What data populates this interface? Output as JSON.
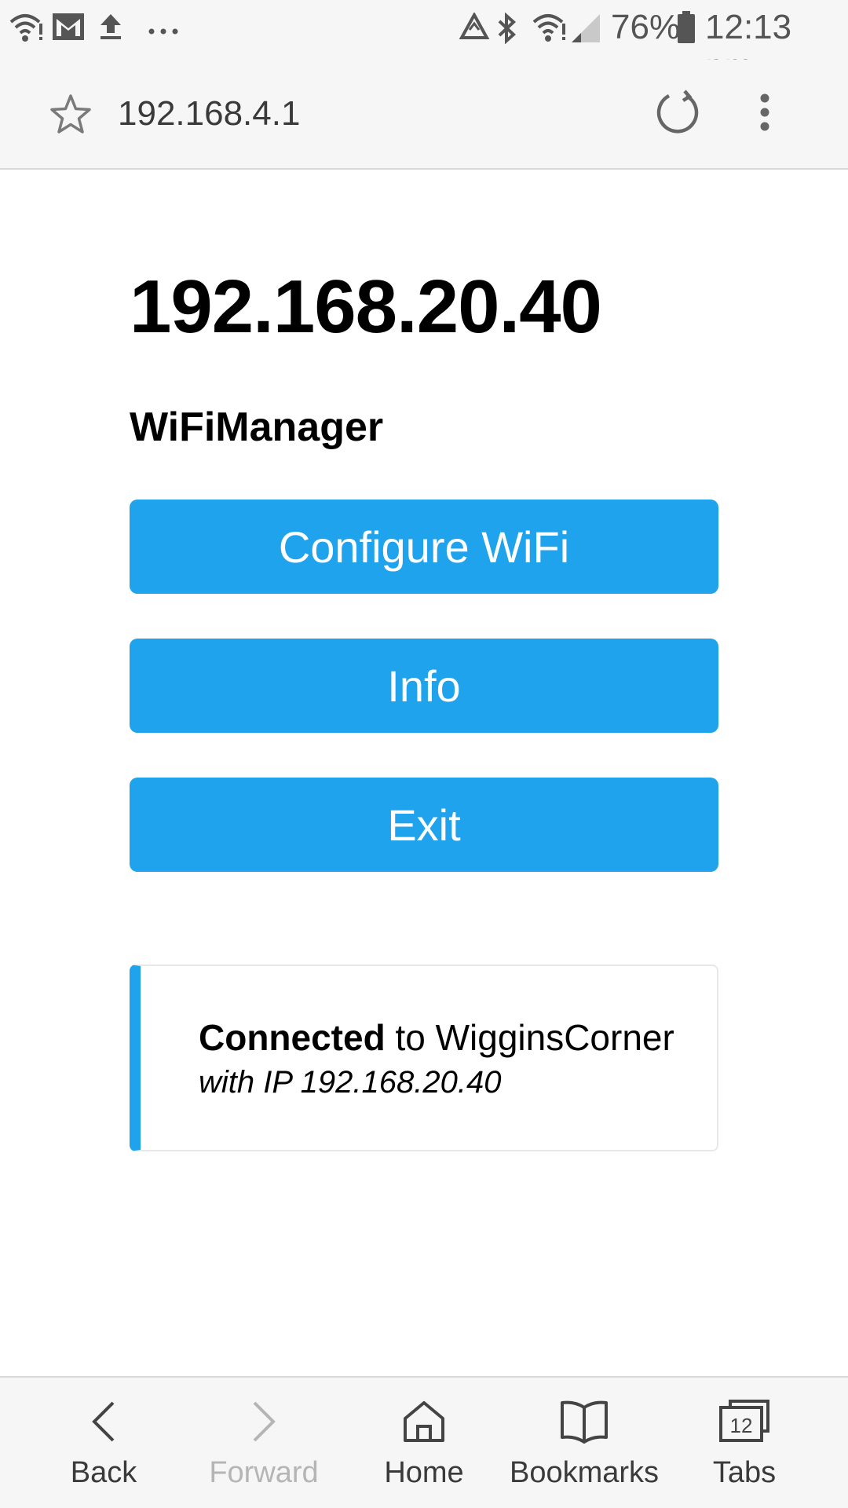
{
  "status_bar": {
    "battery": "76%",
    "time": "12:13 pm"
  },
  "browser": {
    "url": "192.168.4.1"
  },
  "page": {
    "ip_heading": "192.168.20.40",
    "app_title": "WiFiManager",
    "buttons": {
      "configure": "Configure WiFi",
      "info": "Info",
      "exit": "Exit"
    },
    "message": {
      "status_bold": "Connected",
      "status_rest": " to WigginsCorner",
      "ip_line": "with IP 192.168.20.40"
    }
  },
  "bottom_nav": {
    "back": "Back",
    "forward": "Forward",
    "home": "Home",
    "bookmarks": "Bookmarks",
    "tabs": "Tabs",
    "tabs_count": "12"
  },
  "colors": {
    "accent": "#1fa3ec",
    "bar_bg": "#f6f6f6"
  }
}
